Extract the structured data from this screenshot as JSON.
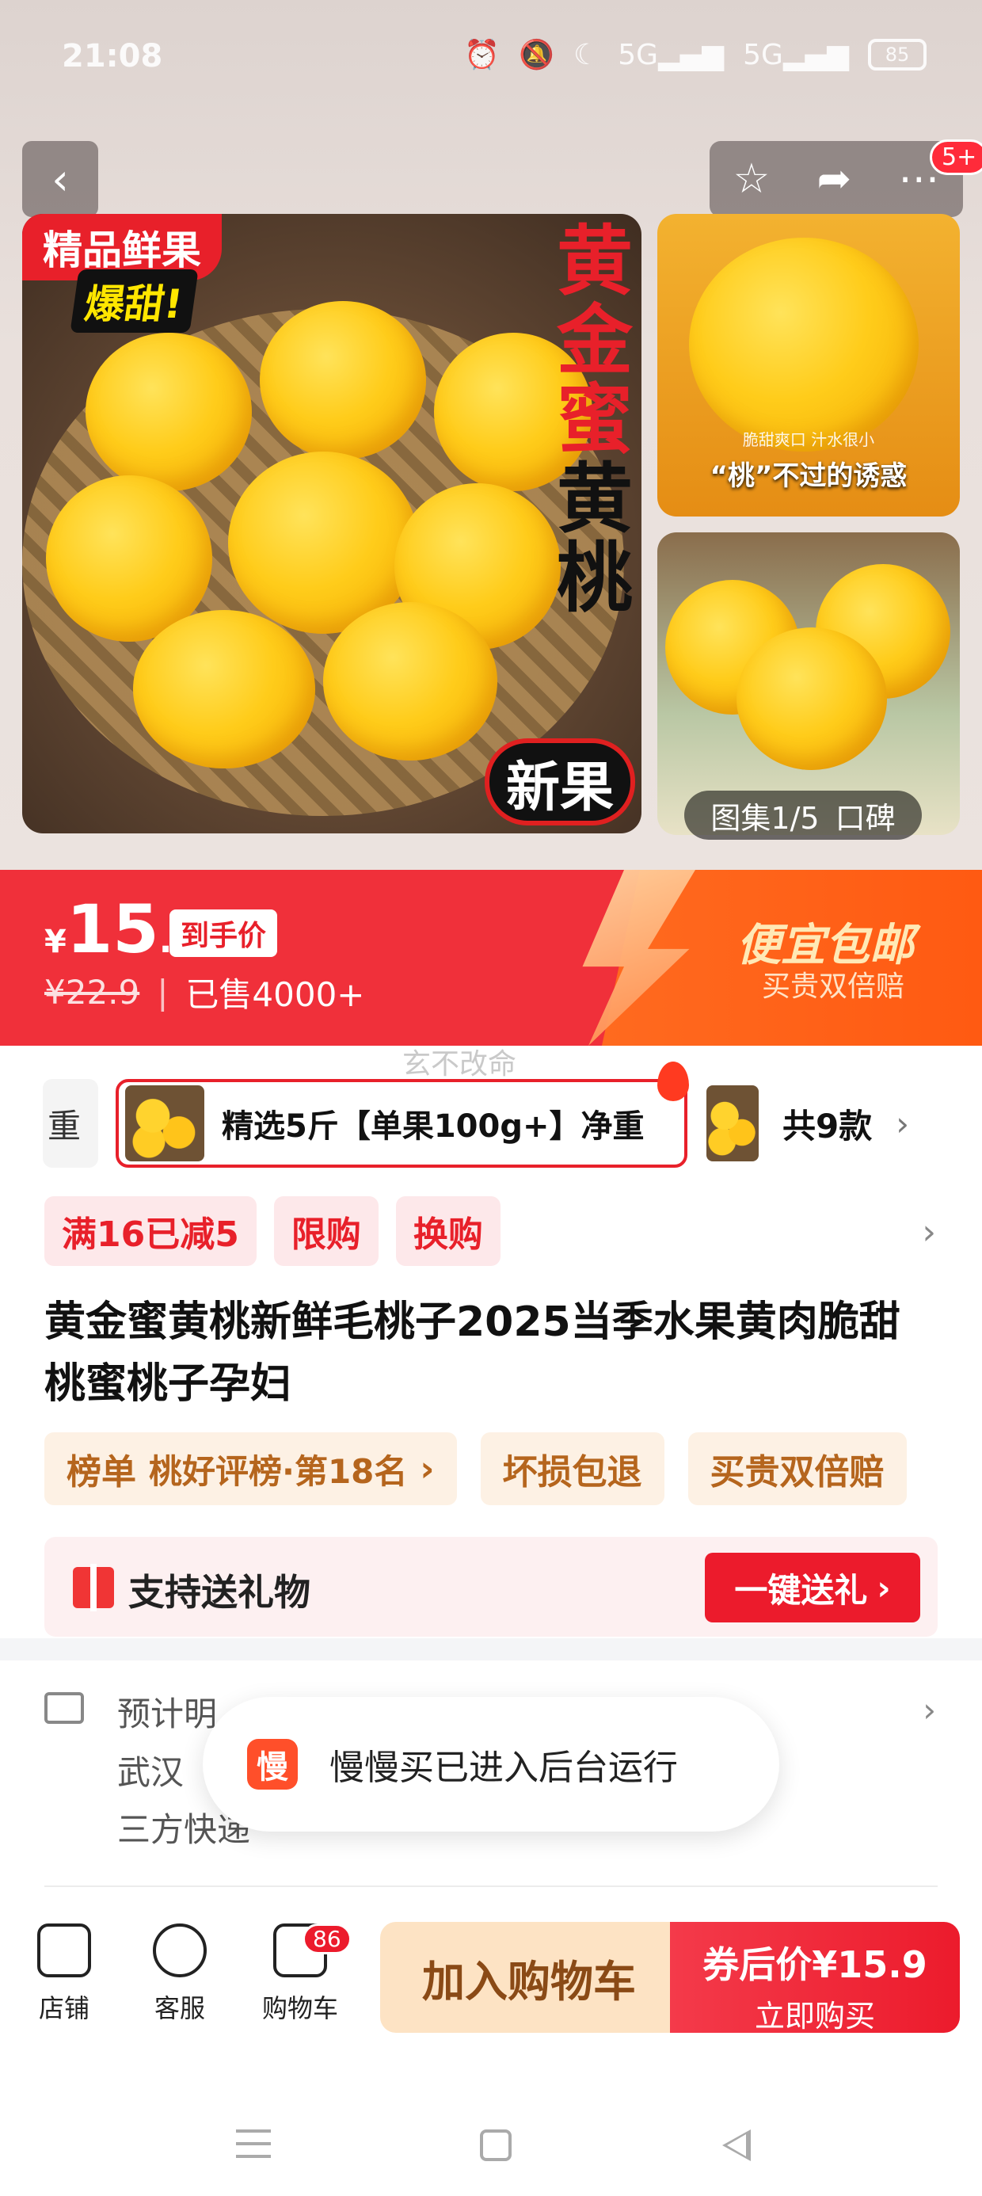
{
  "status": {
    "time": "21:08",
    "battery": "85",
    "net1": "5G",
    "net2": "5G"
  },
  "gallery": {
    "tag_top": "精品鲜果",
    "tag_hot": "爆甜!",
    "vertical_title": [
      "黄",
      "金",
      "蜜",
      "黄",
      "桃"
    ],
    "new_badge": "新果",
    "thumb1_sub": "脆甜爽口 汁水很小",
    "thumb1_caption": "“桃”不过的诱惑",
    "counter": "图集1/5",
    "reviews": "口碑",
    "more_badge": "5+"
  },
  "price": {
    "currency": "¥",
    "integer": "15",
    "decimal": ".9",
    "tag": "到手价",
    "original": "¥22.9",
    "separator": "|",
    "sold": "已售4000+",
    "promo_title": "便宜包邮",
    "promo_sub": "买贵双倍赔"
  },
  "watermark": "玄不改命",
  "sku": {
    "prev_label": "重",
    "selected": "精选5斤【单果100g+】净重",
    "total": "共9款"
  },
  "promo_tags": [
    "满16已减5",
    "限购",
    "换购"
  ],
  "title": "黄金蜜黄桃新鲜毛桃子2025当季水果黄肉脆甜桃蜜桃子孕妇",
  "badges": {
    "rank_label": "榜单",
    "rank_value": "桃好评榜·第18名",
    "chip1": "坏损包退",
    "chip2": "买贵双倍赔"
  },
  "gift": {
    "label": "支持送礼物",
    "button": "一键送礼"
  },
  "delivery": {
    "line1": "预计明",
    "line2": "武汉",
    "line3": "三方快递"
  },
  "toast": {
    "icon_char": "慢",
    "text": "慢慢买已进入后台运行"
  },
  "bottom": {
    "store": "店铺",
    "service": "客服",
    "cart": "购物车",
    "cart_count": "86",
    "add_to_cart": "加入购物车",
    "buy_price": "券后价¥15.9",
    "buy_now": "立即购买"
  },
  "colors": {
    "accent": "#ec1b2c",
    "price_band": "#f0303a",
    "promo_orange": "#ff5a12",
    "chip_bg": "#fdf1e4"
  }
}
